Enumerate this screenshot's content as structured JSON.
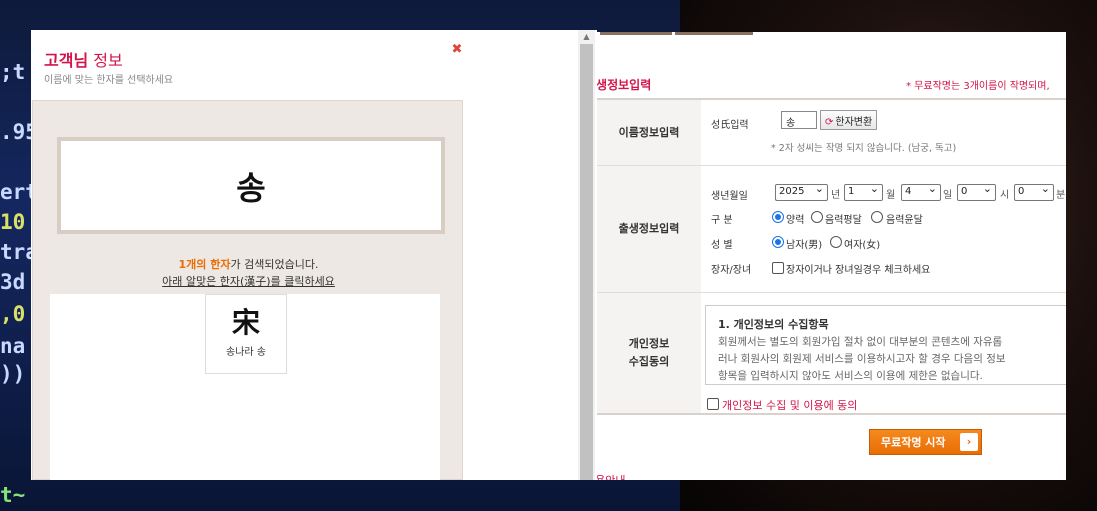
{
  "popup": {
    "title_bold": "고객님",
    "title_rest": " 정보",
    "subtitle": "이름에 맞는 한자를 선택하세요",
    "close_glyph": "✖",
    "name_display": "송",
    "found_count": "1개의 한자",
    "found_rest": "가 검색되었습니다.",
    "click_instruction": "아래 알맞은 한자(漢子)를 클릭하세요",
    "results": [
      {
        "hanja": "宋",
        "meaning": "송나라 송"
      }
    ],
    "scroll_up_glyph": "▲"
  },
  "form": {
    "section_title": "출생정보입력",
    "notice": "* 무료작명는 3개이름이 작명되며,",
    "name_section": {
      "header": "이름정보입력",
      "surname_label": "성氏입력",
      "surname_value": "송",
      "convert_button": "한자변환",
      "convert_icon": "refresh-icon",
      "note": "* 2자 성씨는 작명 되지 않습니다. (남궁, 독고)"
    },
    "birth_section": {
      "header": "출생정보입력",
      "date_label": "생년월일",
      "year": "2025",
      "year_unit": "년",
      "month": "1",
      "month_unit": "월",
      "day": "4",
      "day_unit": "일",
      "hour": "0",
      "hour_unit": "시",
      "minute": "0",
      "minute_unit": "분",
      "calendar_label": "구 분",
      "calendar_options": [
        "양력",
        "음력평달",
        "음력윤달"
      ],
      "calendar_selected": "양력",
      "gender_label": "성 별",
      "gender_options": [
        "남자(男)",
        "여자(女)"
      ],
      "gender_selected": "남자(男)",
      "eldest_label": "장자/장녀",
      "eldest_check_label": "장자이거나 장녀일경우 체크하세요"
    },
    "privacy_section": {
      "header_line1": "개인정보",
      "header_line2": "수집동의",
      "box_title": "1. 개인정보의 수집항목",
      "box_lines": [
        "회원께서는 별도의 회원가입 절차 없이 대부분의 콘텐츠에 자유롭",
        "러나 회원사의 회원제 서비스를 이용하시고자 할 경우 다음의 정보",
        "항목을 입력하시지 않아도 서비스의 이용에 제한은 없습니다."
      ],
      "agree_label": "개인정보 수집 및 이용에 동의"
    },
    "start_button": "무료작명 시작",
    "start_arrow": "›",
    "bottom_text": "사용안내"
  },
  "background": {
    "code_lines": [
      ";t",
      ".95",
      "ert",
      "10",
      "tra",
      "3d",
      ",0",
      "na",
      "))",
      "t~"
    ]
  }
}
